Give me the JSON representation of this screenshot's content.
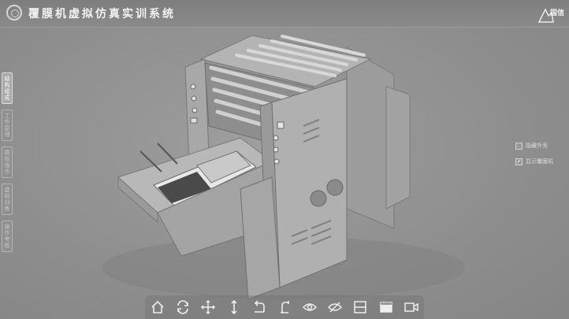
{
  "header": {
    "title": "覆膜机虚拟仿真实训系统",
    "brand_text": "国信"
  },
  "sidebar": {
    "tabs": [
      {
        "label": "结构组成",
        "active": true
      },
      {
        "label": "工作原理",
        "active": false
      },
      {
        "label": "模拟操作",
        "active": false
      },
      {
        "label": "虚拟训练",
        "active": false
      },
      {
        "label": "操作考核",
        "active": false
      }
    ]
  },
  "options": [
    {
      "label": "隐藏外壳",
      "checked": false
    },
    {
      "label": "显示覆膜机",
      "checked": true
    }
  ],
  "toolbar": {
    "tools": [
      {
        "icon": "home-icon"
      },
      {
        "icon": "rotate-icon"
      },
      {
        "icon": "move-icon"
      },
      {
        "icon": "zoom-vertical-icon"
      },
      {
        "icon": "undo-icon"
      },
      {
        "icon": "clamp-icon"
      },
      {
        "icon": "eye-icon"
      },
      {
        "icon": "eye-off-icon"
      },
      {
        "icon": "layout-split-icon"
      },
      {
        "icon": "layout-window-icon"
      },
      {
        "icon": "camera-icon"
      }
    ]
  },
  "colors": {
    "background": "#8c8c8c",
    "title_text": "#f2f2f2",
    "icon": "#eeeeee"
  }
}
